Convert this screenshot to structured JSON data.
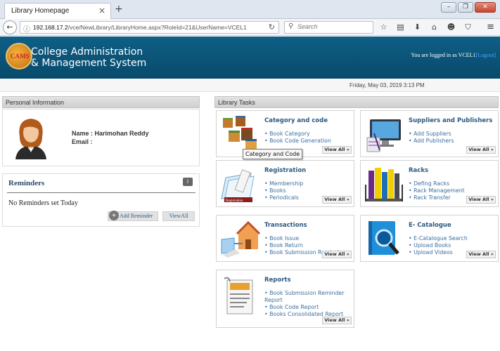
{
  "browser": {
    "tab_title": "Library Homepage",
    "url_host": "192.168.17.2",
    "url_path": "/vce/NewLibrary/LibraryHome.aspx?RoleId=21&UserName=VCEL1",
    "search_placeholder": "Search"
  },
  "app": {
    "logo_text": "CAMS",
    "title_line1": "College Administration",
    "title_line2": "& Management System",
    "login_prefix": "You are logged in as VCEL1",
    "logout_label": "[Logout]",
    "date": "Friday, May 03, 2019 3:13 PM"
  },
  "personal": {
    "section_title": "Personal Information",
    "name_line": "Name : Harimohan Reddy",
    "email_line": "Email :"
  },
  "reminders": {
    "title": "Reminders",
    "empty_text": "No Reminders set Today",
    "add_label": "Add Reminder",
    "view_all_label": "ViewAll"
  },
  "tasks": {
    "section_title": "Library Tasks",
    "view_all_label": "View All »",
    "tooltip": "Category and Code",
    "cards": [
      {
        "title": "Category and code",
        "links": [
          "Book Category",
          "Book Code Generation"
        ]
      },
      {
        "title": "Suppliers and Publishers",
        "links": [
          "Add Suppliers",
          "Add Publishers"
        ]
      },
      {
        "title": "Registration",
        "links": [
          "Membership",
          "Books",
          "Periodicals"
        ]
      },
      {
        "title": "Racks",
        "links": [
          "Defing Racks",
          "Rack Management",
          "Rack Transfer"
        ]
      },
      {
        "title": "Transactions",
        "links": [
          "Book Issue",
          "Book Return",
          "Book Submission Reminder"
        ]
      },
      {
        "title": "E- Catalogue",
        "links": [
          "E-Catalogue Search",
          "Upload Books",
          "Upload Videos"
        ]
      },
      {
        "title": "Reports",
        "links": [
          "Book Submission Reminder Report",
          "Book Code Report",
          "Books Consolidated Report"
        ]
      }
    ]
  },
  "colors": {
    "header_bg": "#0f5f86",
    "card_title": "#2c5a82",
    "link": "#3b6ea0"
  }
}
